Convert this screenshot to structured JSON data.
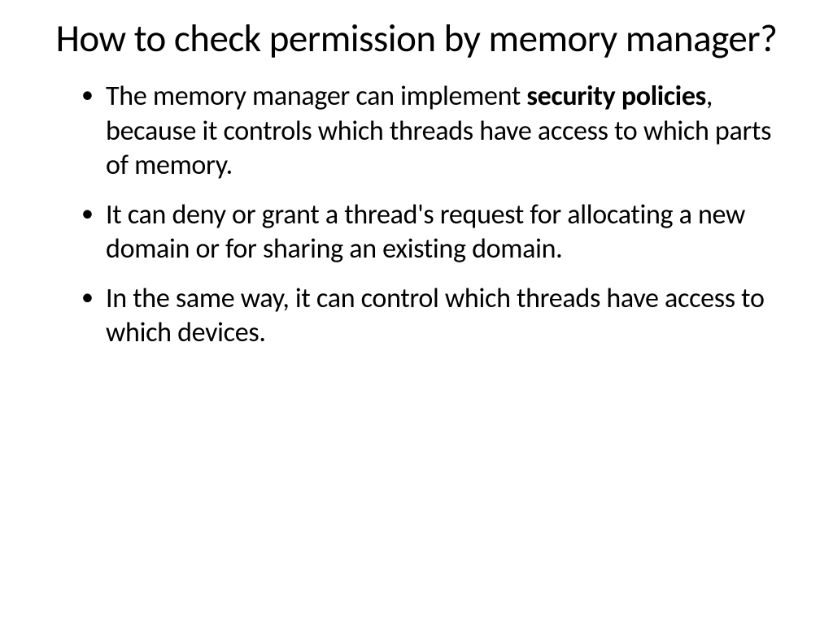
{
  "slide": {
    "title": "How to check permission by memory manager?",
    "bullets": [
      {
        "pre": "The memory manager can implement ",
        "bold": "security policies",
        "post": ", because it controls which threads have access to which parts of memory."
      },
      {
        "pre": "It can deny or grant a thread's request for allocating a new domain or for sharing an existing domain.",
        "bold": "",
        "post": ""
      },
      {
        "pre": "In the same way, it can control which threads have access to which devices.",
        "bold": "",
        "post": ""
      }
    ]
  }
}
